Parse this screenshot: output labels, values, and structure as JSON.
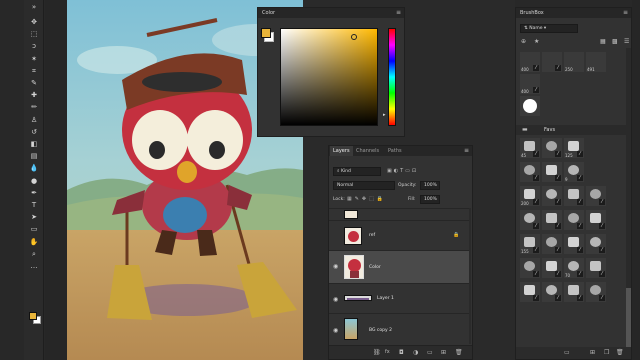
{
  "color_panel": {
    "title": "Color",
    "hue_color": "#ffb800",
    "foreground": "#e8b43a"
  },
  "layers_panel": {
    "tabs": [
      "Layers",
      "Channels",
      "Paths"
    ],
    "filter_kind": "Kind",
    "blend_mode": "Normal",
    "opacity_label": "Opacity:",
    "opacity_value": "100%",
    "lock_label": "Lock:",
    "fill_label": "Fill:",
    "fill_value": "100%",
    "layers": [
      "ref",
      "Color",
      "Layer 1",
      "BG copy 2"
    ],
    "footer_icons": [
      "link-icon",
      "fx-icon",
      "mask-icon",
      "adjustment-icon",
      "group-icon",
      "new-layer-icon",
      "delete-icon"
    ]
  },
  "brushbox_panel": {
    "title": "BrushBox",
    "sort": "Name",
    "folder": "Favs",
    "top_brushes": [
      "400",
      "250",
      "491",
      "400"
    ],
    "favs": [
      [
        "45",
        "",
        "125"
      ],
      [
        "",
        "",
        "9"
      ],
      [
        "200",
        "",
        "",
        ""
      ],
      [
        "",
        "",
        "",
        ""
      ],
      [
        "155",
        "",
        "",
        ""
      ],
      [
        "",
        "",
        "70",
        ""
      ],
      [
        "",
        "",
        "",
        ""
      ]
    ]
  },
  "toolbar": {
    "tools": [
      "move-tool-icon",
      "marquee-tool-icon",
      "lasso-tool-icon",
      "magic-wand-icon",
      "crop-tool-icon",
      "eyedropper-icon",
      "healing-brush-icon",
      "brush-tool-icon",
      "stamp-tool-icon",
      "history-brush-icon",
      "eraser-icon",
      "gradient-tool-icon",
      "blur-tool-icon",
      "dodge-tool-icon",
      "pen-tool-icon",
      "type-tool-icon",
      "path-select-icon",
      "shape-tool-icon",
      "hand-tool-icon",
      "zoom-tool-icon",
      "more-tools-icon"
    ],
    "glyphs": [
      "✥",
      "⬚",
      "ↄ",
      "✶",
      "⌗",
      "✎",
      "✚",
      "✏",
      "♙",
      "↺",
      "◧",
      "▤",
      "💧",
      "●",
      "✒",
      "T",
      "➤",
      "▭",
      "✋",
      "⌕",
      "…"
    ],
    "fg_color": "#e8b43a",
    "bg_color": "#ffffff"
  }
}
